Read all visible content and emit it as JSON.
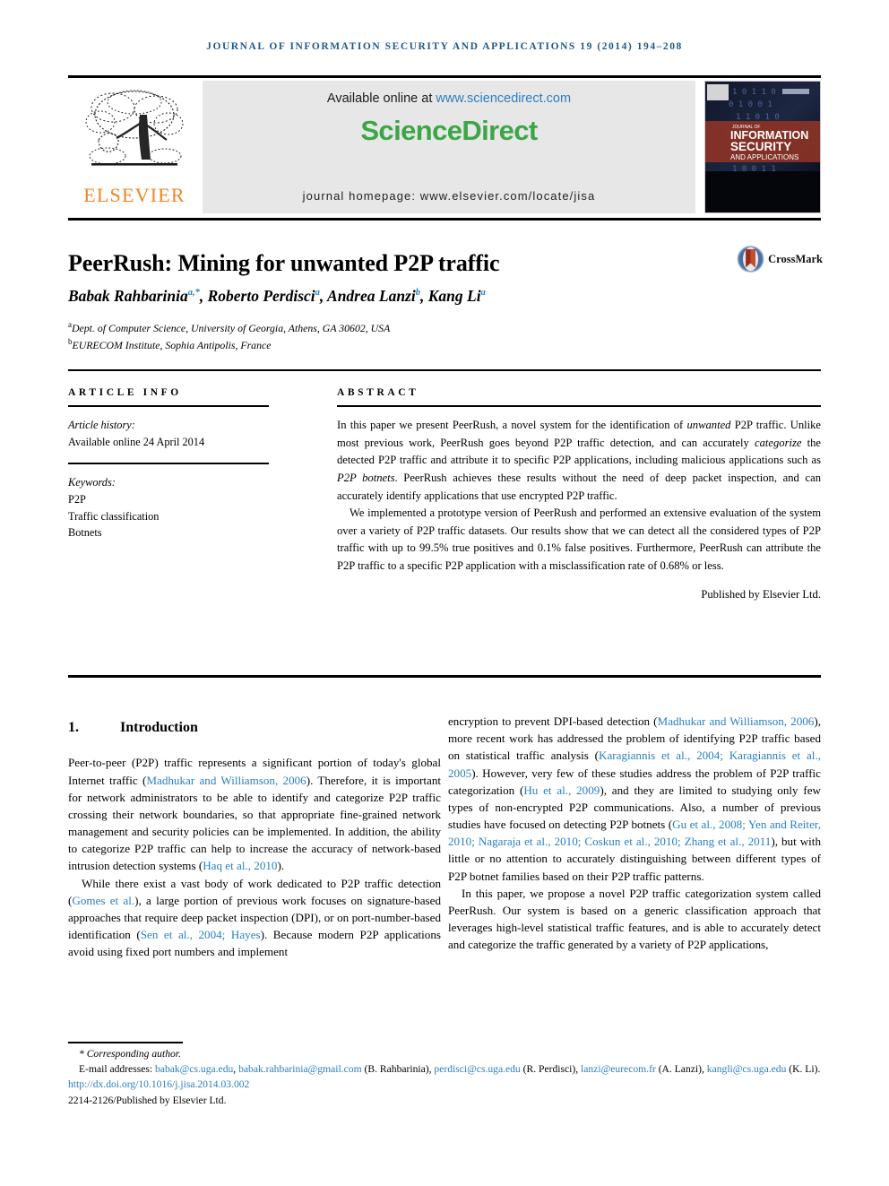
{
  "running_head": "Journal of Information Security and Applications 19 (2014) 194–208",
  "masthead": {
    "publisher_name": "ELSEVIER",
    "available_prefix": "Available online at ",
    "available_url": "www.sciencedirect.com",
    "sciencedirect_logo": "ScienceDirect",
    "journal_homepage": "journal homepage: www.elsevier.com/locate/jisa",
    "cover": {
      "line1": "JOURNAL OF",
      "line2": "INFORMATION",
      "line3": "SECURITY",
      "line4": "AND APPLICATIONS"
    },
    "colors": {
      "sciencedirect_green": "#3CA647",
      "elsevier_orange": "#F08521",
      "link_blue": "#2a7fc0",
      "band_gray": "#e7e7e7"
    }
  },
  "article": {
    "title": "PeerRush: Mining for unwanted P2P traffic",
    "crossmark_label": "CrossMark",
    "authors_html": "Babak Rahbarinia<sup>a,*</sup>, Roberto Perdisci<sup>a</sup>, Andrea Lanzi<sup>b</sup>, Kang Li<sup>a</sup>",
    "affiliation_a": "Dept. of Computer Science, University of Georgia, Athens, GA 30602, USA",
    "affiliation_b": "EURECOM Institute, Sophia Antipolis, France"
  },
  "article_info": {
    "heading": "ARTICLE INFO",
    "history_label": "Article history:",
    "history_value": "Available online 24 April 2014",
    "keywords_label": "Keywords:",
    "keywords": [
      "P2P",
      "Traffic classification",
      "Botnets"
    ]
  },
  "abstract": {
    "heading": "ABSTRACT",
    "paragraph1_html": "In this paper we present PeerRush, a novel system for the identification of <em>unwanted</em> P2P traffic. Unlike most previous work, PeerRush goes beyond P2P traffic detection, and can accurately <em>categorize</em> the detected P2P traffic and attribute it to specific P2P applications, including malicious applications such as <em>P2P botnets</em>. PeerRush achieves these results without the need of deep packet inspection, and can accurately identify applications that use encrypted P2P traffic.",
    "paragraph2_html": "We implemented a prototype version of PeerRush and performed an extensive evaluation of the system over a variety of P2P traffic datasets. Our results show that we can detect all the considered types of P2P traffic with up to 99.5% true positives and 0.1% false positives. Furthermore, PeerRush can attribute the P2P traffic to a specific P2P application with a misclassification rate of 0.68% or less.",
    "published_by": "Published by Elsevier Ltd."
  },
  "body": {
    "section_number": "1.",
    "section_title": "Introduction",
    "left_paragraph1_html": "Peer-to-peer (P2P) traffic represents a significant portion of today's global Internet traffic (<span class=\"cite\">Madhukar and Williamson, 2006</span>). Therefore, it is important for network administrators to be able to identify and categorize P2P traffic crossing their network boundaries, so that appropriate fine-grained network management and security policies can be implemented. In addition, the ability to categorize P2P traffic can help to increase the accuracy of network-based intrusion detection systems (<span class=\"cite\">Haq et al., 2010</span>).",
    "left_paragraph2_html": "While there exist a vast body of work dedicated to P2P traffic detection (<span class=\"cite\">Gomes et al.</span>), a large portion of previous work focuses on signature-based approaches that require deep packet inspection (DPI), or on port-number-based identification (<span class=\"cite\">Sen et al., 2004; Hayes</span>). Because modern P2P applications avoid using fixed port numbers and implement",
    "right_paragraph1_html": "encryption to prevent DPI-based detection (<span class=\"cite\">Madhukar and Williamson, 2006</span>), more recent work has addressed the problem of identifying P2P traffic based on statistical traffic analysis (<span class=\"cite\">Karagiannis et al., 2004; Karagiannis et al., 2005</span>). However, very few of these studies address the problem of P2P traffic categorization (<span class=\"cite\">Hu et al., 2009</span>), and they are limited to studying only few types of non-encrypted P2P communications. Also, a number of previous studies have focused on detecting P2P botnets (<span class=\"cite\">Gu et al., 2008; Yen and Reiter, 2010; Nagaraja et al., 2010; Coskun et al., 2010; Zhang et al., 2011</span>), but with little or no attention to accurately distinguishing between different types of P2P botnet families based on their P2P traffic patterns.",
    "right_paragraph2_html": "In this paper, we propose a novel P2P traffic categorization system called PeerRush. Our system is based on a generic classification approach that leverages high-level statistical traffic features, and is able to accurately detect and categorize the traffic generated by a variety of P2P applications,"
  },
  "footnotes": {
    "corresponding_author": "* Corresponding author.",
    "email_html": "E-mail addresses: <span class=\"cite\">babak@cs.uga.edu</span>, <span class=\"cite\">babak.rahbarinia@gmail.com</span> (B. Rahbarinia), <span class=\"cite\">perdisci@cs.uga.edu</span> (R. Perdisci), <span class=\"cite\">lanzi@eurecom.fr</span> (A. Lanzi), <span class=\"cite\">kangli@cs.uga.edu</span> (K. Li).",
    "doi": "http://dx.doi.org/10.1016/j.jisa.2014.03.002",
    "issn_line": "2214-2126/Published by Elsevier Ltd."
  }
}
